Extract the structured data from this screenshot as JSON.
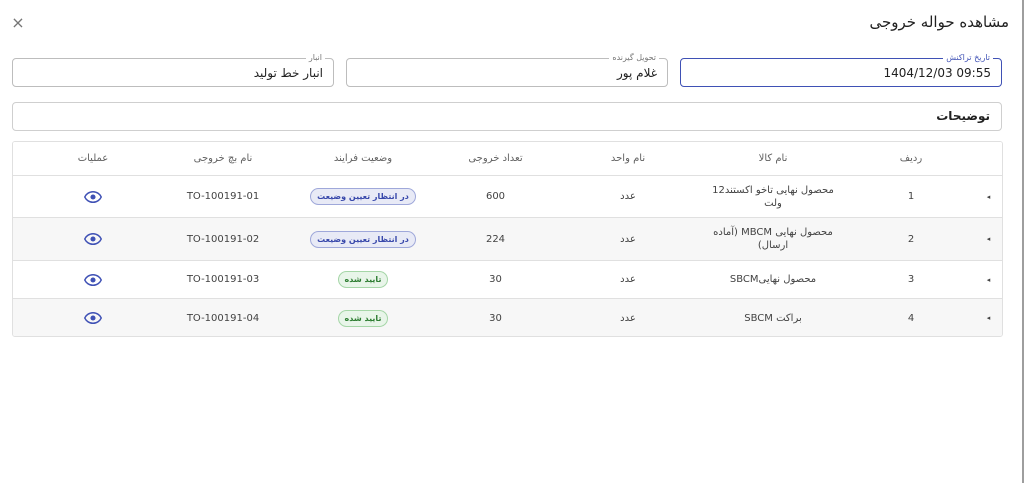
{
  "dialog": {
    "title": "مشاهده حواله خروجی",
    "close_icon": "×"
  },
  "fields": {
    "transaction_date": {
      "label": "تاریخ تراکنش",
      "value": "1404/12/03 09:55"
    },
    "receiver": {
      "label": "تحویل گیرنده",
      "value": "غلام پور"
    },
    "warehouse": {
      "label": "انبار",
      "value": "انبار خط تولید"
    }
  },
  "description": {
    "label": "توضیحات"
  },
  "table": {
    "headers": {
      "row": "ردیف",
      "product": "نام کالا",
      "unit": "نام واحد",
      "quantity": "تعداد خروجی",
      "status": "وضعیت فرایند",
      "batch": "نام بچ خروجی",
      "actions": "عملیات"
    },
    "rows": [
      {
        "row": "1",
        "product": "محصول نهایی تاخو اکستند12 ولت",
        "unit": "عدد",
        "quantity": "600",
        "status": "در انتظار تعیین وضیعت",
        "status_kind": "pending",
        "batch": "TO-100191-01",
        "expander": "◂"
      },
      {
        "row": "2",
        "product": "محصول نهایی MBCM (آماده ارسال)",
        "unit": "عدد",
        "quantity": "224",
        "status": "در انتظار تعیین وضیعت",
        "status_kind": "pending",
        "batch": "TO-100191-02",
        "expander": "◂"
      },
      {
        "row": "3",
        "product": "محصول نهاییSBCM",
        "unit": "عدد",
        "quantity": "30",
        "status": "تایید شده",
        "status_kind": "ok",
        "batch": "TO-100191-03",
        "expander": "◂"
      },
      {
        "row": "4",
        "product": "براکت SBCM",
        "unit": "عدد",
        "quantity": "30",
        "status": "تایید شده",
        "status_kind": "ok",
        "batch": "TO-100191-04",
        "expander": "◂"
      }
    ]
  },
  "colors": {
    "accent": "#3f51b5",
    "eye_icon": "#3f51b5",
    "pending_badge": "#3949ab",
    "approved_badge": "#2e7d32"
  },
  "icons": {
    "close": "close-icon",
    "view": "eye-icon",
    "expand": "caret-left-icon"
  }
}
